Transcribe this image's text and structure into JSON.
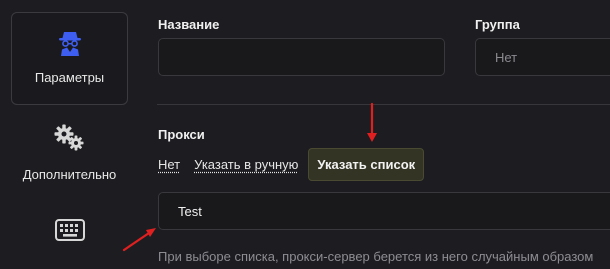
{
  "nav": {
    "items": [
      {
        "label": "Параметры",
        "icon": "spy-agent-icon",
        "active": true
      },
      {
        "label": "Дополнительно",
        "icon": "gears-icon"
      },
      {
        "label": "",
        "icon": "keyboard-icon"
      }
    ]
  },
  "form": {
    "name": {
      "label": "Название",
      "value": ""
    },
    "group": {
      "label": "Группа",
      "value": "Нет"
    },
    "proxy": {
      "label": "Прокси",
      "tabs": [
        "Нет",
        "Указать в ручную",
        "Указать список"
      ],
      "active_tab": "Указать список",
      "value": "Test",
      "hint": "При выборе списка, прокси-сервер берется из него случайным образом"
    }
  },
  "colors": {
    "background": "#1d1d21",
    "accent_icon": "#3d5ef0",
    "annotation_arrow": "#e02020",
    "active_tab_bg": "#343424"
  }
}
